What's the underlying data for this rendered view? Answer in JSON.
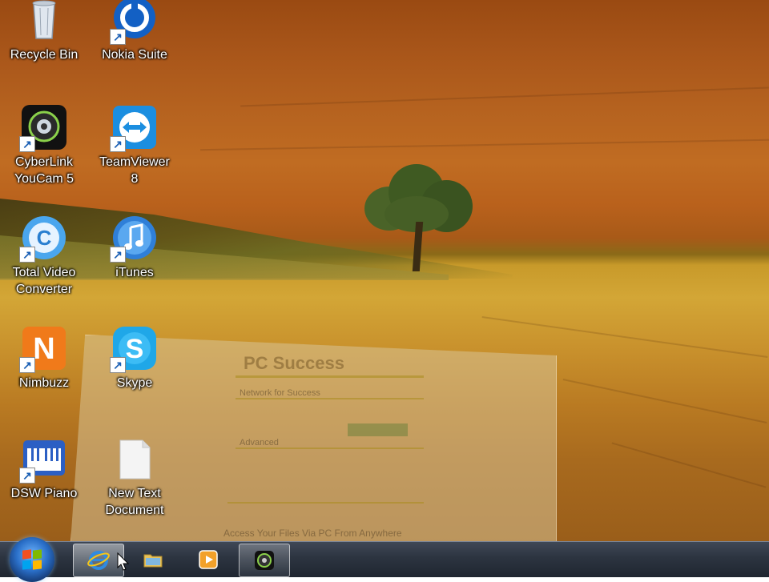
{
  "desktop": {
    "icons": [
      {
        "label": "Recycle Bin",
        "icon": "recycle-bin-icon"
      },
      {
        "label": "Nokia Suite",
        "icon": "nokia-suite-icon"
      },
      {
        "label": "CyberLink\nYouCam 5",
        "icon": "youcam-icon"
      },
      {
        "label": "TeamViewer\n8",
        "icon": "teamviewer-icon"
      },
      {
        "label": "Total Video\nConverter",
        "icon": "total-video-converter-icon"
      },
      {
        "label": "iTunes",
        "icon": "itunes-icon"
      },
      {
        "label": "Nimbuzz",
        "icon": "nimbuzz-icon"
      },
      {
        "label": "Skype",
        "icon": "skype-icon"
      },
      {
        "label": "DSW Piano",
        "icon": "piano-icon"
      },
      {
        "label": "New Text\nDocument",
        "icon": "text-document-icon"
      }
    ]
  },
  "ghost_window": {
    "brand": "PC Success",
    "section1": "Network for Success",
    "section2": "Advanced",
    "footer": "Access Your Files Via PC From Anywhere"
  },
  "taskbar": {
    "buttons": [
      {
        "name": "internet-explorer",
        "icon": "ie-icon"
      },
      {
        "name": "windows-explorer",
        "icon": "folder-icon"
      },
      {
        "name": "media-player",
        "icon": "media-player-icon"
      },
      {
        "name": "webcam-app",
        "icon": "webcam-icon"
      }
    ]
  },
  "colors": {
    "taskbar": "#2c3440",
    "start_orb": "#2a6fc8",
    "field_top": "#b5621f",
    "field_bottom": "#d3a636"
  }
}
